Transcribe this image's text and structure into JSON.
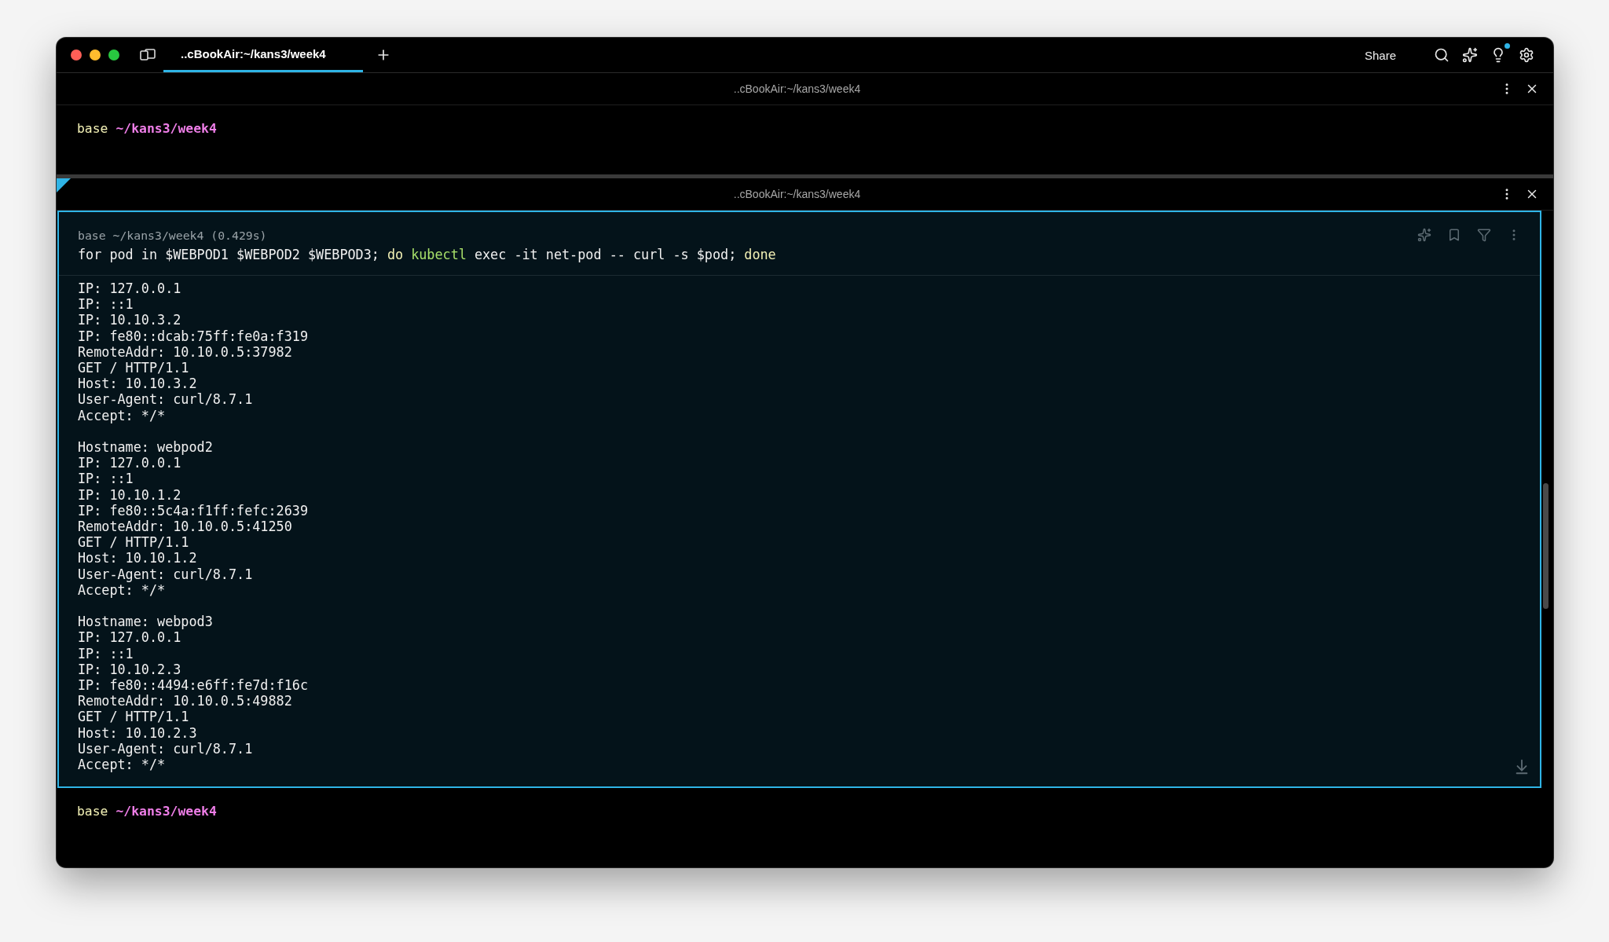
{
  "tab_bar": {
    "tabs": [
      {
        "label": "..cBookAir:~/kans3/week4",
        "selected": true
      }
    ],
    "share": "Share",
    "has_notification": true
  },
  "panes": [
    {
      "title": "..cBookAir:~/kans3/week4",
      "focused": false,
      "prompt": {
        "env": "base",
        "path": "~/kans3/week4"
      }
    },
    {
      "title": "..cBookAir:~/kans3/week4",
      "focused": true,
      "block": {
        "header": "base ~/kans3/week4 (0.429s)",
        "command": [
          {
            "kind": "plain",
            "text": "for pod in $WEBPOD1 $WEBPOD2 $WEBPOD3;"
          },
          {
            "kind": "keyword",
            "text": "do"
          },
          {
            "kind": "program",
            "text": "kubectl"
          },
          {
            "kind": "plain",
            "text": "exec -it net-pod -- curl -s $pod;"
          },
          {
            "kind": "keyword",
            "text": "done"
          }
        ],
        "output": [
          [
            "IP: 127.0.0.1",
            "IP: ::1",
            "IP: 10.10.3.2",
            "IP: fe80::dcab:75ff:fe0a:f319",
            "RemoteAddr: 10.10.0.5:37982",
            "GET / HTTP/1.1",
            "Host: 10.10.3.2",
            "User-Agent: curl/8.7.1",
            "Accept: */*"
          ],
          [
            "Hostname: webpod2",
            "IP: 127.0.0.1",
            "IP: ::1",
            "IP: 10.10.1.2",
            "IP: fe80::5c4a:f1ff:fefc:2639",
            "RemoteAddr: 10.10.0.5:41250",
            "GET / HTTP/1.1",
            "Host: 10.10.1.2",
            "User-Agent: curl/8.7.1",
            "Accept: */*"
          ],
          [
            "Hostname: webpod3",
            "IP: 127.0.0.1",
            "IP: ::1",
            "IP: 10.10.2.3",
            "IP: fe80::4494:e6ff:fe7d:f16c",
            "RemoteAddr: 10.10.0.5:49882",
            "GET / HTTP/1.1",
            "Host: 10.10.2.3",
            "User-Agent: curl/8.7.1",
            "Accept: */*"
          ]
        ]
      },
      "prompt": {
        "env": "base",
        "path": "~/kans3/week4"
      }
    }
  ]
}
